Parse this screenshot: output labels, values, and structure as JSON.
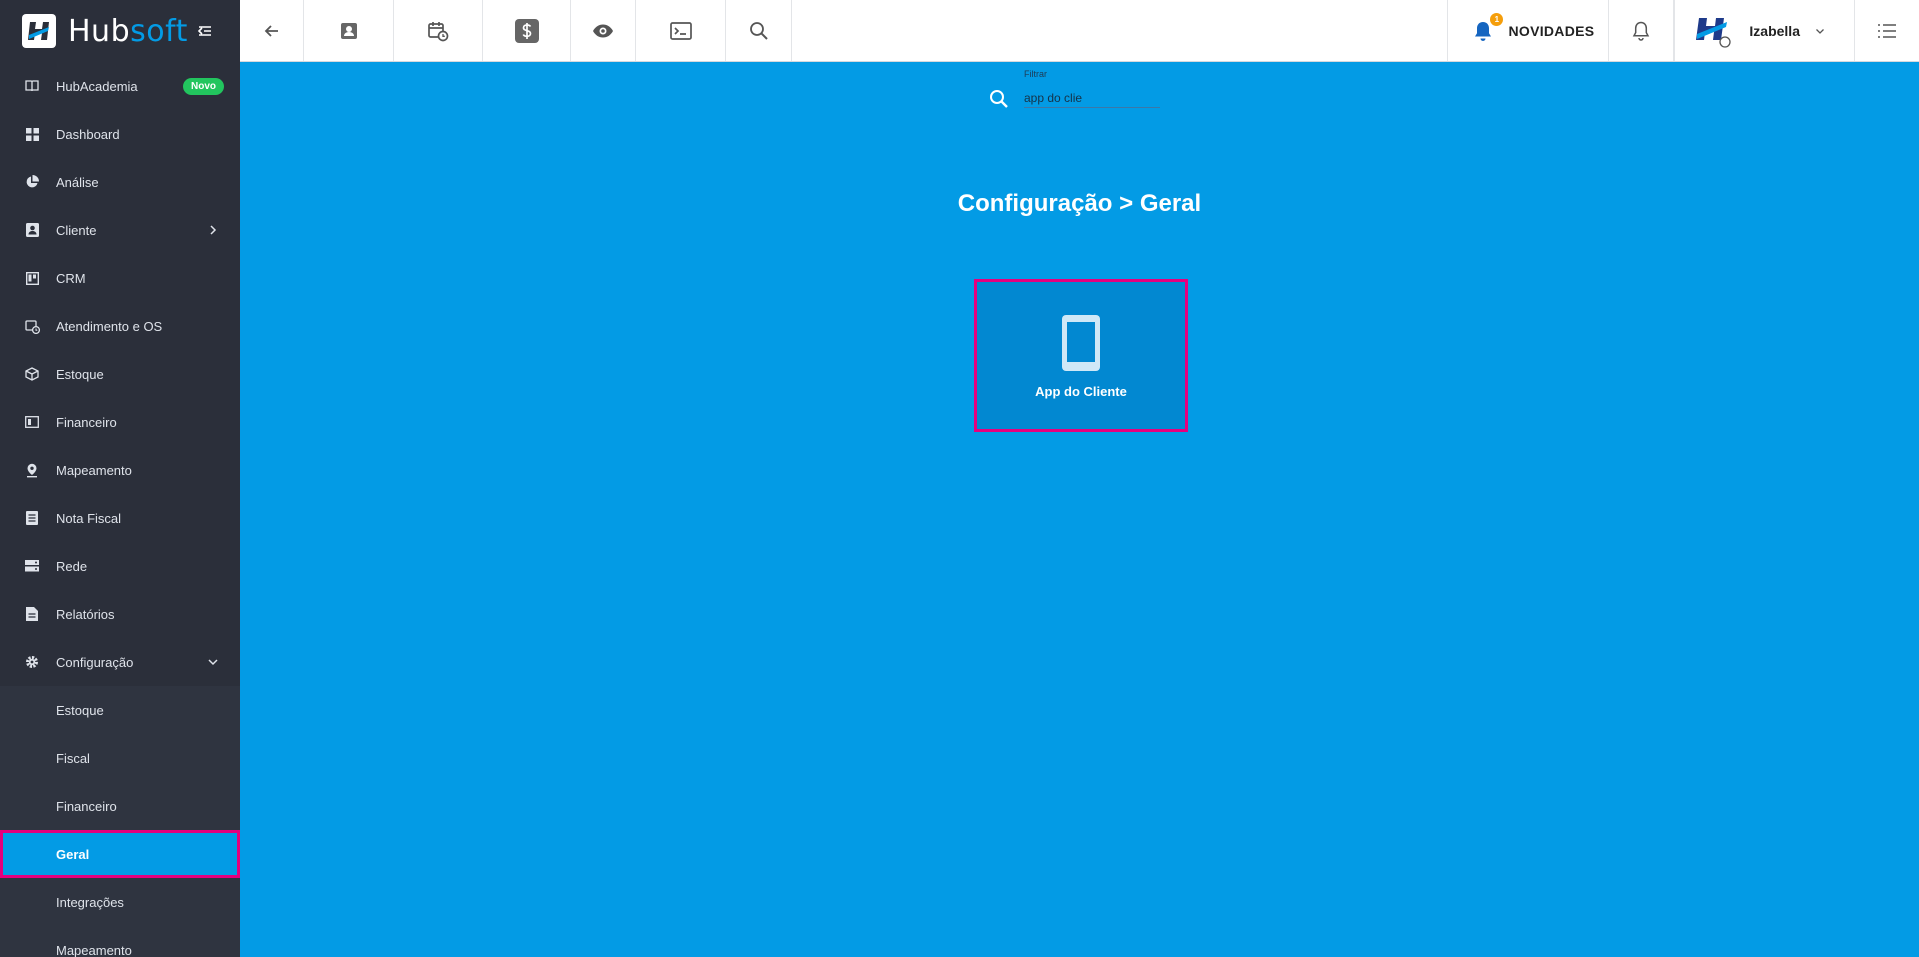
{
  "brand": {
    "name_part1": "Hub",
    "name_part2": "soft"
  },
  "sidebar": {
    "items": [
      {
        "label": "HubAcademia",
        "icon": "book-icon",
        "badge": "Novo"
      },
      {
        "label": "Dashboard",
        "icon": "grid-icon"
      },
      {
        "label": "Análise",
        "icon": "pie-chart-icon"
      },
      {
        "label": "Cliente",
        "icon": "contact-icon",
        "chevron": "right"
      },
      {
        "label": "CRM",
        "icon": "board-icon"
      },
      {
        "label": "Atendimento e OS",
        "icon": "calendar-clock-icon"
      },
      {
        "label": "Estoque",
        "icon": "box-icon"
      },
      {
        "label": "Financeiro",
        "icon": "money-icon"
      },
      {
        "label": "Mapeamento",
        "icon": "map-pin-icon"
      },
      {
        "label": "Nota Fiscal",
        "icon": "receipt-icon"
      },
      {
        "label": "Rede",
        "icon": "server-icon"
      },
      {
        "label": "Relatórios",
        "icon": "report-icon"
      },
      {
        "label": "Configuração",
        "icon": "gear-icon",
        "chevron": "down"
      }
    ],
    "sub_items": [
      {
        "label": "Estoque"
      },
      {
        "label": "Fiscal"
      },
      {
        "label": "Financeiro"
      },
      {
        "label": "Geral",
        "active": true
      },
      {
        "label": "Integrações"
      },
      {
        "label": "Mapeamento"
      }
    ]
  },
  "topbar": {
    "buttons": [
      "back-arrow-icon",
      "contact-card-icon",
      "calendar-clock-icon",
      "dollar-icon",
      "eye-icon",
      "terminal-icon",
      "search-icon"
    ],
    "novidades_label": "NOVIDADES",
    "novidades_count": "1",
    "user_name": "Izabella"
  },
  "filter": {
    "label": "Filtrar",
    "value": "app do clie"
  },
  "breadcrumb": {
    "section": "Configuração",
    "separator": ">",
    "page": "Geral"
  },
  "cards": [
    {
      "label": "App do Cliente",
      "icon": "smartphone-icon"
    }
  ],
  "colors": {
    "accent": "#039be5",
    "sidebar": "#2b2f3a",
    "highlight": "#e6007e",
    "card": "#0288d1",
    "badge": "#22c55e"
  }
}
